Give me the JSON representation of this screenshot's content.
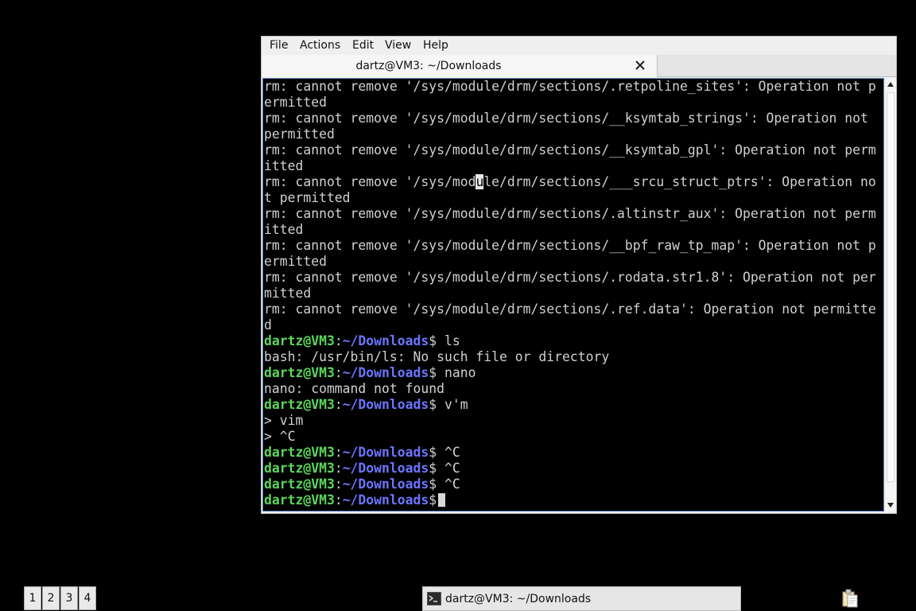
{
  "menu": {
    "file": "File",
    "actions": "Actions",
    "edit": "Edit",
    "view": "View",
    "help": "Help"
  },
  "tab": {
    "title": "dartz@VM3: ~/Downloads"
  },
  "terminal": {
    "prompt_user": "dartz@VM3",
    "prompt_path": "~/Downloads",
    "lines": [
      "rm: cannot remove '/sys/module/drm/sections/.retpoline_sites': Operation not p",
      "ermitted",
      "rm: cannot remove '/sys/module/drm/sections/__ksymtab_strings': Operation not",
      "permitted",
      "rm: cannot remove '/sys/module/drm/sections/__ksymtab_gpl': Operation not perm",
      "itted",
      "t permitted",
      "rm: cannot remove '/sys/module/drm/sections/.altinstr_aux': Operation not perm",
      "itted",
      "rm: cannot remove '/sys/module/drm/sections/__bpf_raw_tp_map': Operation not p",
      "ermitted",
      "rm: cannot remove '/sys/module/drm/sections/.rodata.str1.8': Operation not per",
      "mitted",
      "rm: cannot remove '/sys/module/drm/sections/.ref.data': Operation not permitte",
      "d",
      "bash: /usr/bin/ls: No such file or directory",
      "nano: command not found",
      "> vim",
      "> ^C"
    ],
    "srcu_before": "rm: cannot remove '/sys/mod",
    "srcu_highlight": "u",
    "srcu_after": "le/drm/sections/___srcu_struct_ptrs': Operation no",
    "commands": [
      "ls",
      "nano",
      "v'm",
      "^C",
      "^C",
      "^C"
    ]
  },
  "taskbar": {
    "desktops": [
      "1",
      "2",
      "3",
      "4"
    ],
    "window_label": "dartz@VM3: ~/Downloads",
    "icons": {
      "terminal": "terminal-icon",
      "clipboard": "clipboard-icon",
      "close": "close-icon"
    }
  },
  "colors": {
    "prompt_user": "#5cd65c",
    "prompt_path": "#6b75ff",
    "terminal_bg": "#000000",
    "text": "#d0d0d0"
  }
}
